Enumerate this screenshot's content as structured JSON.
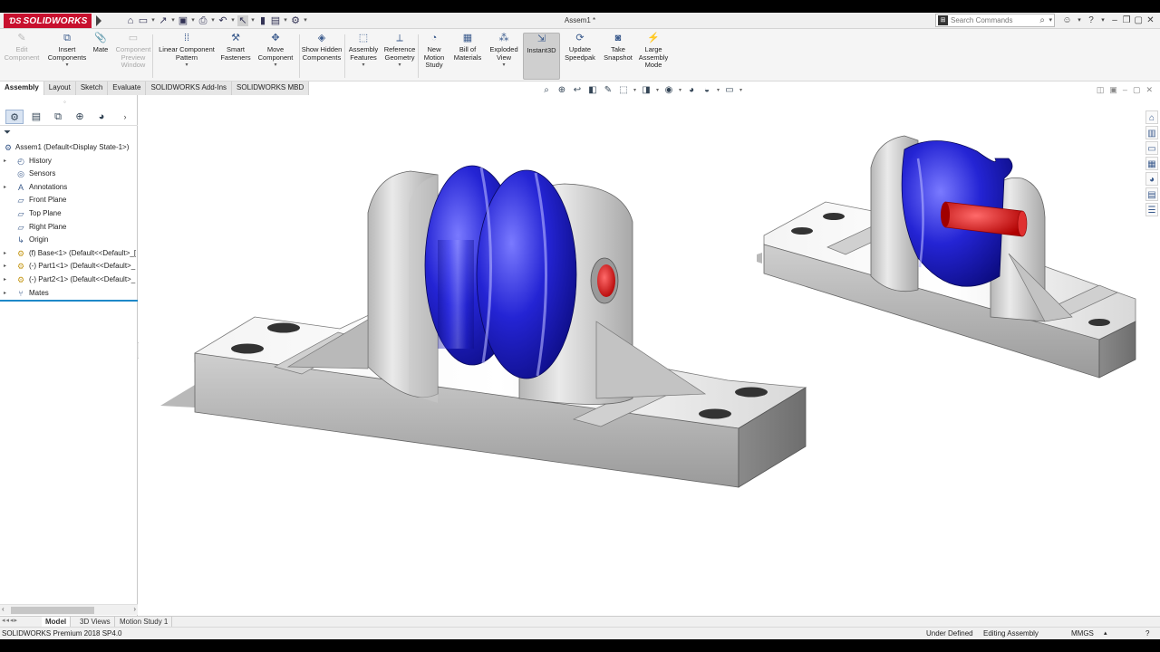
{
  "app": {
    "logo_text": "SOLIDWORKS",
    "document_title": "Assem1 *",
    "search_placeholder": "Search Commands"
  },
  "ribbon": {
    "buttons": [
      {
        "label": "Edit Component",
        "icon": "edit-component-icon",
        "enabled": false
      },
      {
        "label": "Insert Components",
        "icon": "insert-components-icon",
        "enabled": true
      },
      {
        "label": "Mate",
        "icon": "mate-icon",
        "enabled": true
      },
      {
        "label": "Component Preview Window",
        "icon": "preview-window-icon",
        "enabled": false
      },
      {
        "label": "Linear Component Pattern",
        "icon": "pattern-icon",
        "enabled": true
      },
      {
        "label": "Smart Fasteners",
        "icon": "smart-fasteners-icon",
        "enabled": true
      },
      {
        "label": "Move Component",
        "icon": "move-component-icon",
        "enabled": true
      },
      {
        "label": "Show Hidden Components",
        "icon": "show-hidden-icon",
        "enabled": true
      },
      {
        "label": "Assembly Features",
        "icon": "assembly-features-icon",
        "enabled": true
      },
      {
        "label": "Reference Geometry",
        "icon": "reference-geometry-icon",
        "enabled": true
      },
      {
        "label": "New Motion Study",
        "icon": "motion-study-icon",
        "enabled": true
      },
      {
        "label": "Bill of Materials",
        "icon": "bom-icon",
        "enabled": true
      },
      {
        "label": "Exploded View",
        "icon": "exploded-view-icon",
        "enabled": true
      },
      {
        "label": "Instant3D",
        "icon": "instant3d-icon",
        "enabled": true,
        "active": true
      },
      {
        "label": "Update Speedpak",
        "icon": "speedpak-icon",
        "enabled": true
      },
      {
        "label": "Take Snapshot",
        "icon": "snapshot-icon",
        "enabled": true
      },
      {
        "label": "Large Assembly Mode",
        "icon": "large-assembly-icon",
        "enabled": true
      }
    ]
  },
  "command_tabs": [
    "Assembly",
    "Layout",
    "Sketch",
    "Evaluate",
    "SOLIDWORKS Add-Ins",
    "SOLIDWORKS MBD"
  ],
  "feature_tree": {
    "root": "Assem1  (Default<Display State-1>)",
    "items": [
      {
        "label": "History",
        "icon": "history-icon",
        "expandable": true
      },
      {
        "label": "Sensors",
        "icon": "sensors-icon",
        "expandable": false
      },
      {
        "label": "Annotations",
        "icon": "annotations-icon",
        "expandable": true
      },
      {
        "label": "Front Plane",
        "icon": "plane-icon",
        "expandable": false
      },
      {
        "label": "Top Plane",
        "icon": "plane-icon",
        "expandable": false
      },
      {
        "label": "Right Plane",
        "icon": "plane-icon",
        "expandable": false
      },
      {
        "label": "Origin",
        "icon": "origin-icon",
        "expandable": false
      },
      {
        "label": "(f) Base<1> (Default<<Default>_[",
        "icon": "part-icon",
        "expandable": true
      },
      {
        "label": "(-) Part1<1> (Default<<Default>_",
        "icon": "part-icon",
        "expandable": true
      },
      {
        "label": "(-) Part2<1> (Default<<Default>_",
        "icon": "part-icon",
        "expandable": true
      },
      {
        "label": "Mates",
        "icon": "mates-icon",
        "expandable": true
      }
    ]
  },
  "bottom_tabs": [
    "Model",
    "3D Views",
    "Motion Study 1"
  ],
  "status_bar": {
    "product": "SOLIDWORKS Premium 2018 SP4.0",
    "state": "Under Defined",
    "mode": "Editing Assembly",
    "units": "MMGS"
  },
  "colors": {
    "roller": "#2a2ad8",
    "shaft": "#d42020",
    "base": "#c4c4c4"
  }
}
